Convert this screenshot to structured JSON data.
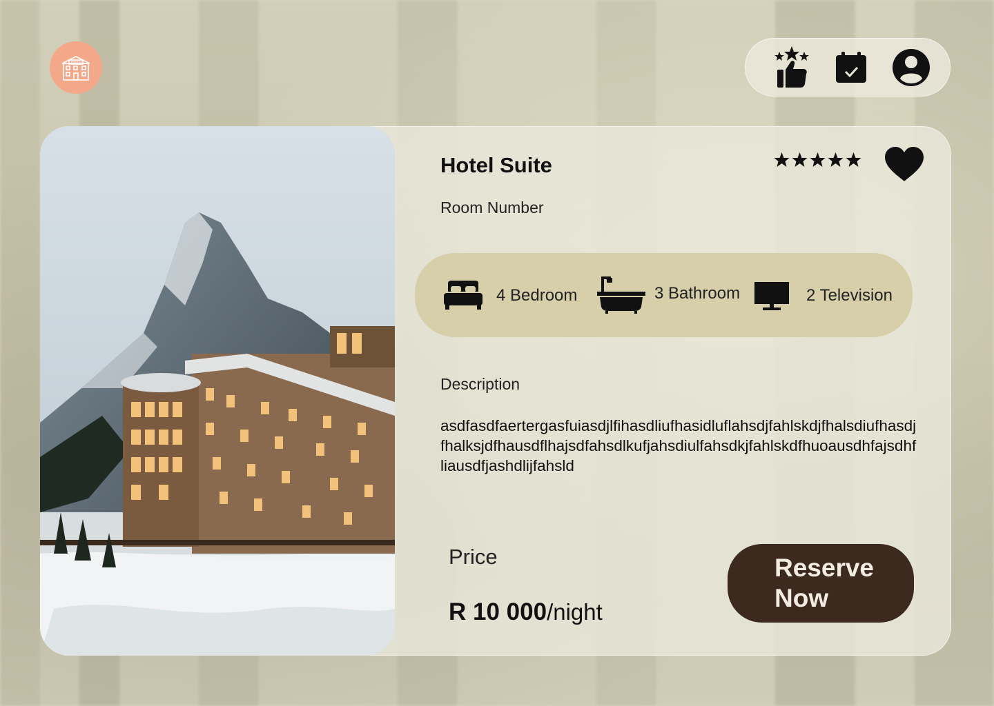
{
  "header": {
    "logo_icon": "hotel-building-icon",
    "nav": [
      {
        "icon": "rating-thumbs-up-icon"
      },
      {
        "icon": "calendar-check-icon"
      },
      {
        "icon": "user-account-icon"
      }
    ]
  },
  "listing": {
    "title": "Hotel Suite",
    "room_number_label": "Room Number",
    "rating": 5,
    "favorite_icon": "heart-icon",
    "amenities": [
      {
        "icon": "bed-icon",
        "label": "4 Bedroom"
      },
      {
        "icon": "bathtub-icon",
        "label": "3 Bathroom"
      },
      {
        "icon": "television-icon",
        "label": "2 Television"
      }
    ],
    "description_heading": "Description",
    "description": "asdfasdfaertergasfuiasdjlfihasdliufhasidluflahsdjfahlskdjfhalsdiufhasdjfhalksjdfhausdflhajsdfahsdlkufjahsdiulfahsdkjfahlskdfhuoausdhfajsdhfliausdfjashdlijfahsld",
    "price_heading": "Price",
    "price_amount": "R 10 000",
    "price_unit": "/night",
    "reserve_label": "Reserve Now"
  },
  "colors": {
    "accent_logo": "#f3a989",
    "amenity_bar": "#d6cfa9",
    "reserve_button": "#3d2a1f",
    "card": "#eae8db"
  }
}
